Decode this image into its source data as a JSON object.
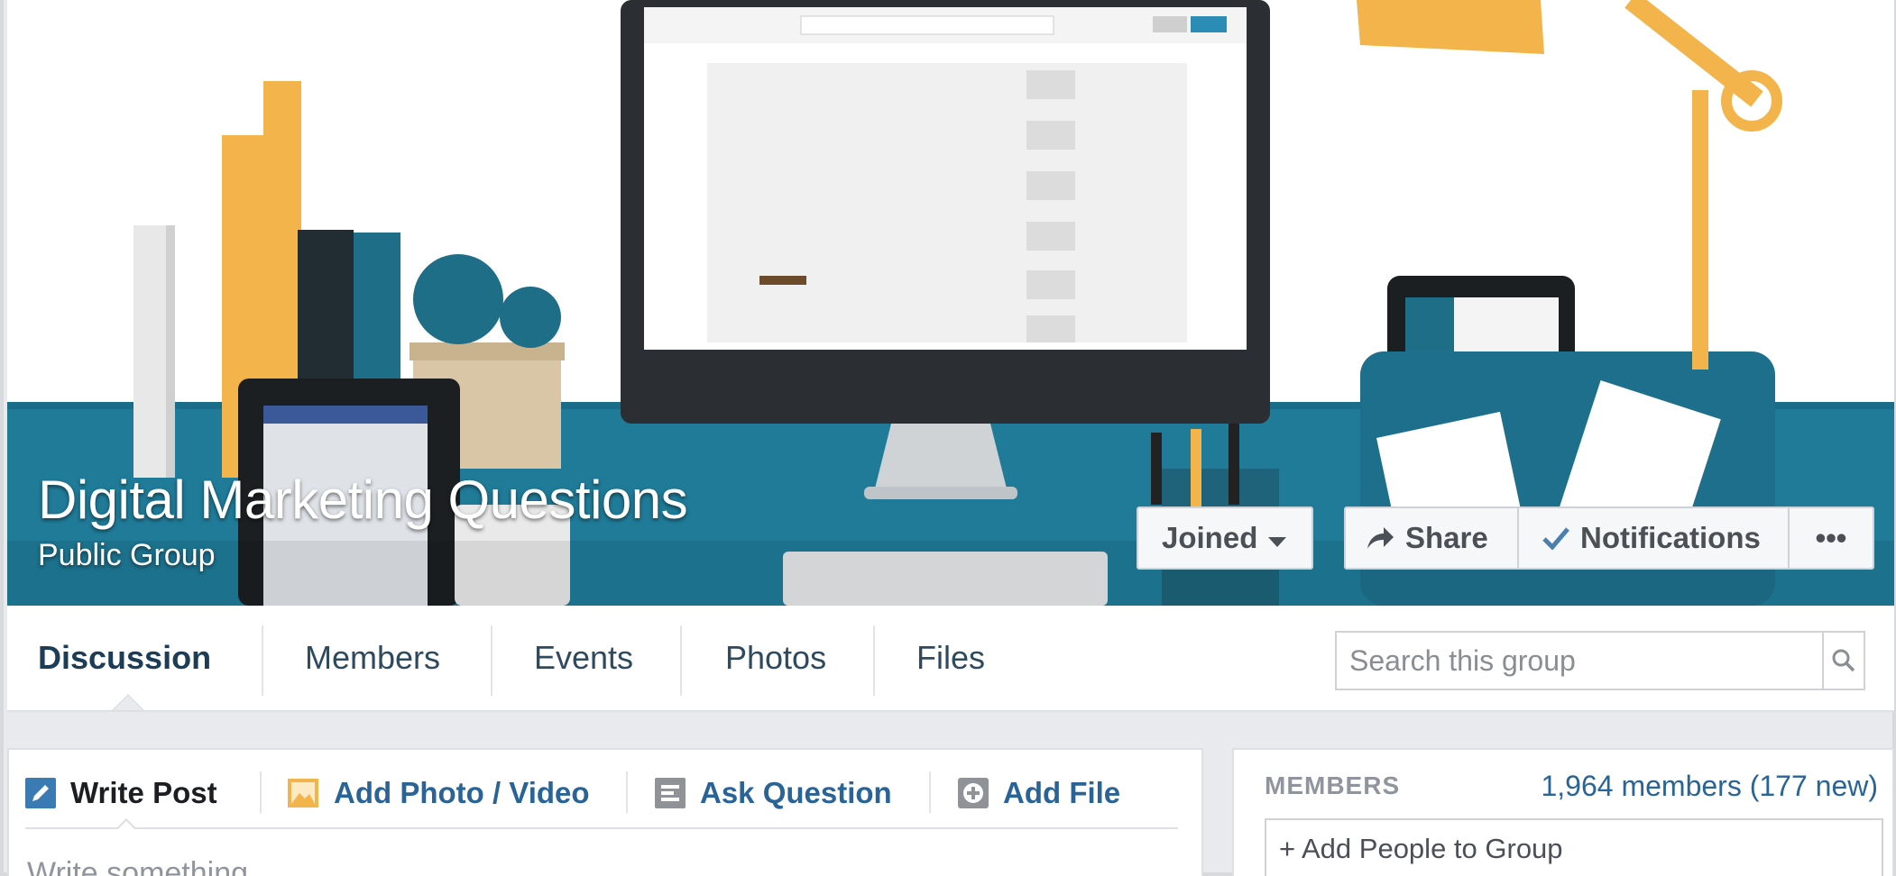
{
  "group": {
    "title": "Digital Marketing Questions",
    "privacy": "Public Group"
  },
  "cover_buttons": {
    "joined": "Joined",
    "share": "Share",
    "notifications": "Notifications",
    "more": "•••"
  },
  "nav": {
    "tabs": [
      {
        "label": "Discussion",
        "active": true
      },
      {
        "label": "Members",
        "active": false
      },
      {
        "label": "Events",
        "active": false
      },
      {
        "label": "Photos",
        "active": false
      },
      {
        "label": "Files",
        "active": false
      }
    ],
    "search_placeholder": "Search this group"
  },
  "composer": {
    "tabs": [
      {
        "label": "Write Post",
        "icon": "pencil-icon"
      },
      {
        "label": "Add Photo / Video",
        "icon": "photo-icon"
      },
      {
        "label": "Ask Question",
        "icon": "question-list-icon"
      },
      {
        "label": "Add File",
        "icon": "add-file-icon"
      }
    ],
    "placeholder": "Write something..."
  },
  "members": {
    "heading": "MEMBERS",
    "count": "1,964 members (177 new)",
    "add_people": "+ Add People to Group"
  },
  "colors": {
    "teal": "#1f7b98",
    "accent_orange": "#f3b44b",
    "link_blue": "#2a6496"
  }
}
